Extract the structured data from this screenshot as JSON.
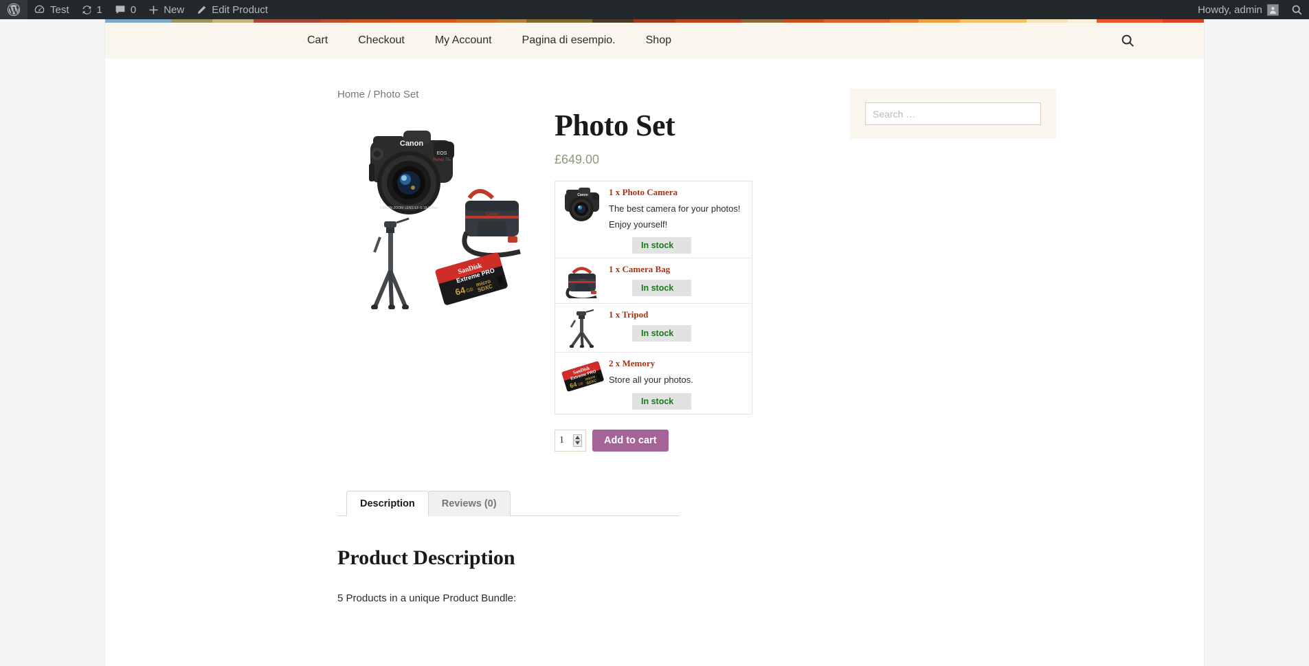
{
  "adminbar": {
    "wp_logo_label": "wordpress-logo",
    "site_name": "Test",
    "updates_count": "1",
    "comments_count": "0",
    "new_label": "New",
    "edit_label": "Edit Product",
    "howdy": "Howdy, admin",
    "search_label": "search-icon"
  },
  "stripe_colors": [
    "#7ca8c9",
    "#9b9563",
    "#c2b47a",
    "#a8453c",
    "#b8502f",
    "#c9541f",
    "#d4591c",
    "#c96a22",
    "#b0803a",
    "#7d6b2e",
    "#4a3a26",
    "#9e3a1c",
    "#b8441f",
    "#8a6a3c",
    "#c4521f",
    "#d4622a",
    "#e07a2c",
    "#eaa03e",
    "#f0c268",
    "#f5e3b8",
    "#f7efd8",
    "#e8552f",
    "#d94427"
  ],
  "nav": {
    "items": [
      {
        "label": "Cart"
      },
      {
        "label": "Checkout"
      },
      {
        "label": "My Account"
      },
      {
        "label": "Pagina di esempio."
      },
      {
        "label": "Shop"
      }
    ]
  },
  "breadcrumb": {
    "home": "Home",
    "separator": "/",
    "current": "Photo Set"
  },
  "product": {
    "title": "Photo Set",
    "price": "£649.00",
    "image_alt": "photo-set-bundle-image",
    "quantity": "1",
    "add_to_cart_label": "Add to cart",
    "bundle_items": [
      {
        "name": "1 x Photo Camera",
        "desc": [
          "The best camera for your photos!",
          "Enjoy yourself!"
        ],
        "stock": "In stock",
        "thumb": "camera"
      },
      {
        "name": "1 x Camera Bag",
        "desc": [],
        "stock": "In stock",
        "thumb": "bag"
      },
      {
        "name": "1 x Tripod",
        "desc": [],
        "stock": "In stock",
        "thumb": "tripod"
      },
      {
        "name": "2 x Memory",
        "desc": [
          "Store all your photos."
        ],
        "stock": "In stock",
        "thumb": "memory"
      }
    ]
  },
  "tabs": [
    {
      "label": "Description",
      "active": true
    },
    {
      "label": "Reviews (0)",
      "active": false
    }
  ],
  "description_panel": {
    "heading": "Product Description",
    "text": "5 Products in a unique Product Bundle:"
  },
  "sidebar": {
    "search_placeholder": "Search …",
    "search_value": ""
  },
  "colors": {
    "price": "#8a9a79",
    "bundle_name": "#a83214",
    "in_stock": "#1a7a1a",
    "add_to_cart": "#a46497",
    "nav_bg": "#faf6ed",
    "adminbar_bg": "#23282d"
  }
}
